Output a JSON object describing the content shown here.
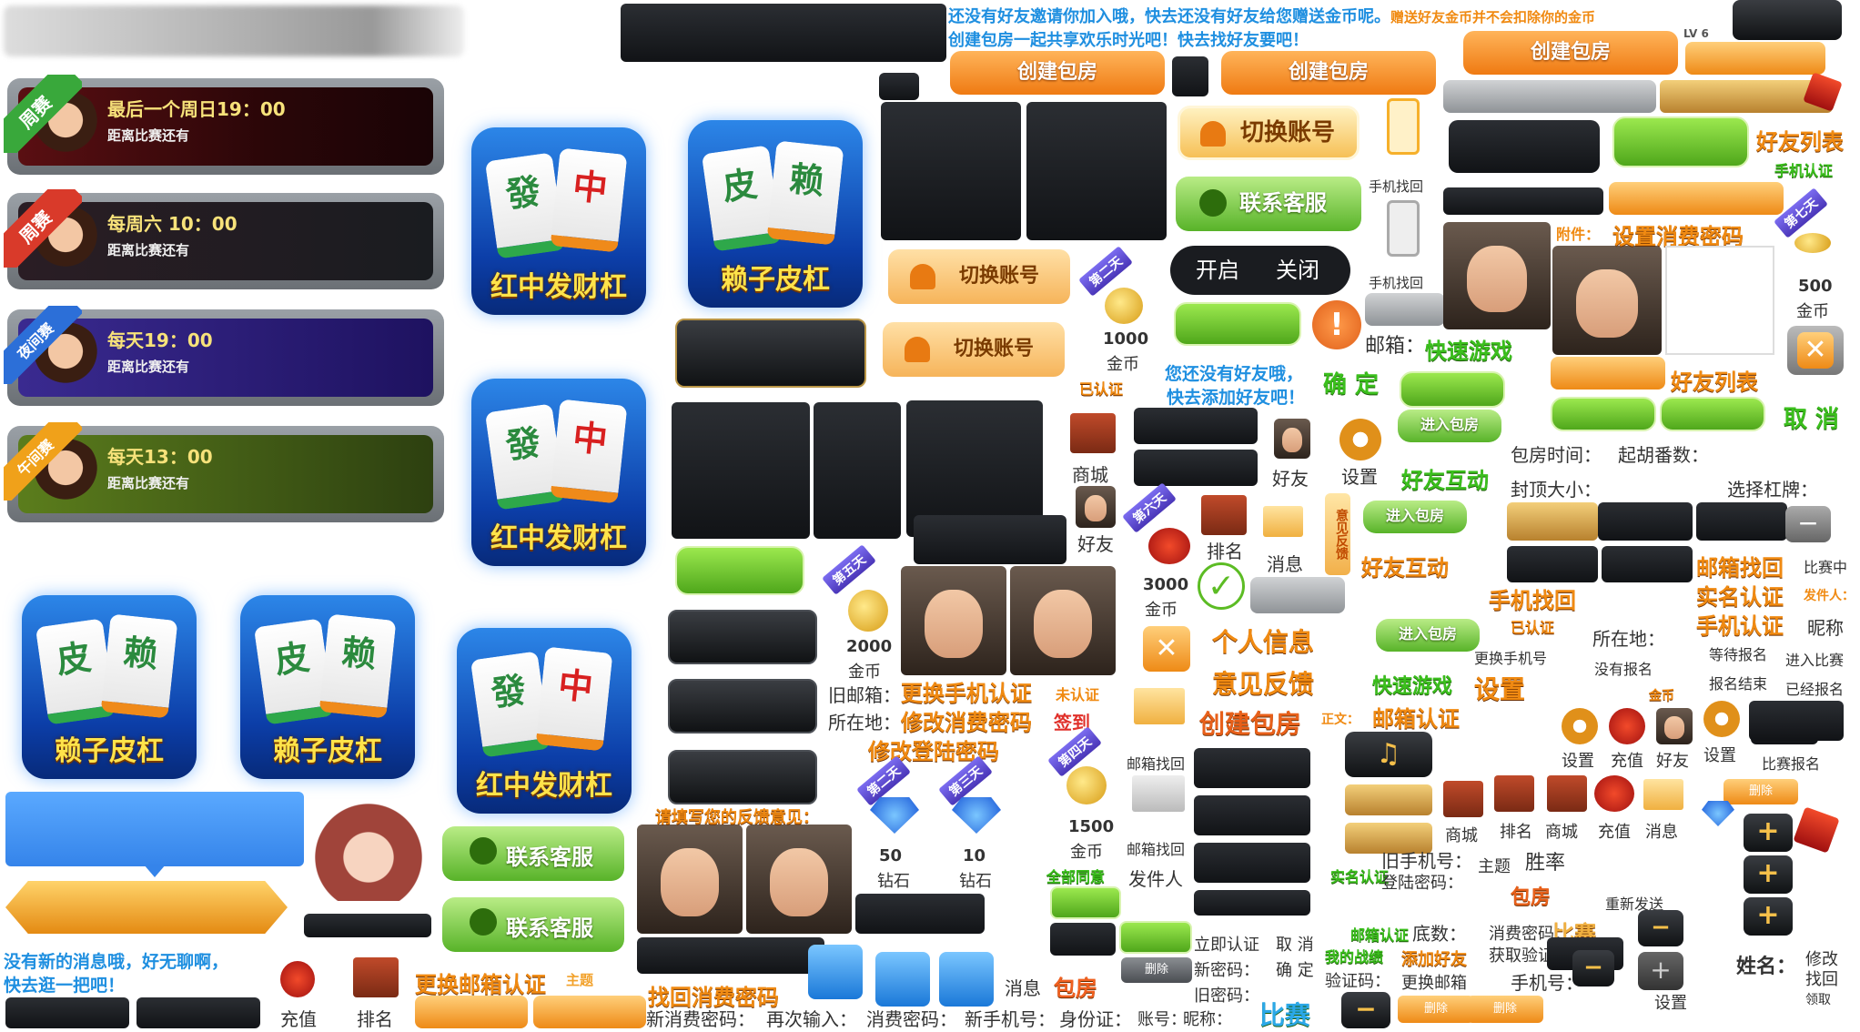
{
  "banners": [
    {
      "tag": "周赛",
      "title": "最后一个周日19：00",
      "sub": "距离比赛还有",
      "bg": "#4a0e10",
      "ribbon": "#39a83b"
    },
    {
      "tag": "周赛",
      "title": "每周六 10：00",
      "sub": "距离比赛还有",
      "bg": "#1b1d22",
      "ribbon": "#d93a2a"
    },
    {
      "tag": "夜间赛",
      "title": "每天19：00",
      "sub": "距离比赛还有",
      "bg": "#2a1a6b",
      "ribbon": "#2c6fd8"
    },
    {
      "tag": "午间赛",
      "title": "每天13：00",
      "sub": "距离比赛还有",
      "bg": "#3d5a14",
      "ribbon": "#f0a11a"
    }
  ],
  "games": {
    "hongzhong": {
      "name": "红中发财杠",
      "tile1": "發",
      "tile2": "中"
    },
    "laizi": {
      "name": "赖子皮杠",
      "tile1": "皮",
      "tile2": "赖"
    }
  },
  "top_notice": {
    "line1": "还没有好友邀请你加入哦，快去还没有好友给您赠送金币呢。",
    "line1b": "赠送好友金币并不会扣除你的金币",
    "line2": "创建包房一起共享欢乐时光吧！快去找好友要吧！"
  },
  "buttons": {
    "create_room": "创建包房",
    "switch_account": "切换账号",
    "contact_service": "联系客服",
    "enter_room": "进入包房",
    "friend_list": "好友列表",
    "delete": "删除",
    "on": "开启",
    "off": "关闭",
    "confirm": "确 定",
    "cancel": "取 消"
  },
  "rewards": [
    {
      "day": "第二天",
      "amount": "1000",
      "unit": "金币"
    },
    {
      "day": "第五天",
      "amount": "2000",
      "unit": "金币"
    },
    {
      "day": "第六天",
      "amount": "3000",
      "unit": "金币"
    },
    {
      "day": "第四天",
      "amount": "1500",
      "unit": "金币"
    },
    {
      "day": "第七天",
      "amount": "500",
      "unit": "金币"
    },
    {
      "day": "第二天",
      "amount": "50",
      "unit": "钻石"
    },
    {
      "day": "第三天",
      "amount": "10",
      "unit": "钻石"
    }
  ],
  "labels": {
    "phone_recover": "手机找回",
    "mailbox": "邮箱：",
    "quick_game": "快速游戏",
    "attachment": "附件：",
    "set_pay_pwd": "设置消费密码",
    "no_friend_1": "您还没有好友哦，",
    "no_friend_2": "快去添加好友吧！",
    "verified": "已认证",
    "shop": "商城",
    "friends": "好友",
    "settings": "设置",
    "friend_interact": "好友互动",
    "room_time": "包房时间：",
    "start_fan": "起胡番数：",
    "cap_size": "封顶大小：",
    "select_laizi": "选择杠牌：",
    "rank": "排名",
    "message": "消息",
    "feedback": "意见反馈",
    "personal_info": "个人信息",
    "old_mail": "旧邮箱：",
    "change_phone_cert": "更换手机认证",
    "location": "所在地：",
    "modify_pay_pwd": "修改消费密码",
    "sign_in": "签到",
    "modify_login_pwd": "修改登陆密码",
    "fill_feedback": "请填写您的反馈意见：",
    "mail_recover": "邮箱找回",
    "real_name": "实名认证",
    "phone_cert": "手机认证",
    "nickname": "昵称",
    "in_match": "比赛中",
    "sender": "发件人：",
    "change_phone": "更换手机号",
    "no_signup": "没有报名",
    "signup_end": "报名结束",
    "signed_up": "已经报名",
    "wait_signup": "等待报名",
    "enter_match": "进入比赛",
    "match_signup": "比赛报名",
    "recharge": "充值",
    "resend": "重新发送",
    "subject": "主题",
    "old_phone": "旧手机号：",
    "login_pwd": "登陆密码：",
    "win_rate": "胜率",
    "all_agree": "全部同意",
    "sender2": "发件人",
    "instant_cert": "立即认证",
    "new_pwd": "新密码：",
    "old_pwd": "旧密码：",
    "mail_cert": "邮箱认证",
    "my_record": "我的战绩",
    "add_friend": "添加好友",
    "verify_code": "验证码：",
    "change_mail": "更换邮箱",
    "base": "底数：",
    "pay_pwd": "消费密码：",
    "get_code": "获取验证码",
    "phone_no": "手机号：",
    "find_pay_pwd": "找回消费密码",
    "new_pay_pwd": "新消费密码：",
    "again": "再次输入：",
    "pay_pwd2": "消费密码：",
    "new_phone": "新手机号：",
    "id_card": "身份证：",
    "account": "账号：",
    "nick": "昵称：",
    "no_message_1": "没有新的消息哦，好无聊啊，",
    "no_message_2": "快去逛一把吧！",
    "change_mail_cert": "更换邮箱认证",
    "match": "比赛",
    "room": "包房",
    "level": "LV 6",
    "name": "姓名：",
    "modify": "修改",
    "recover": "找回",
    "claim": "领取",
    "forward": "正文：",
    "not_verified": "未认证"
  },
  "colors": {
    "orange": "#f08a12",
    "green": "#5cbc24",
    "blue": "#1f8fe0",
    "dark": "#1a1c20"
  }
}
